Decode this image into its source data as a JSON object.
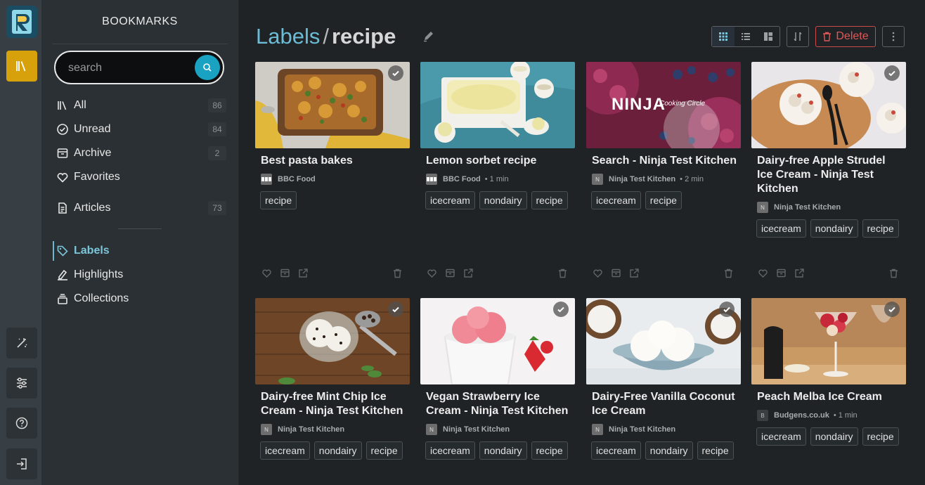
{
  "rail": {
    "logo_letter": "R",
    "items": [
      {
        "name": "bookmarks",
        "icon": "library-icon",
        "active": true
      },
      {
        "name": "nav-toggle",
        "icon": "magic-wand-icon"
      },
      {
        "name": "settings",
        "icon": "sliders-icon"
      },
      {
        "name": "help",
        "icon": "help-circle-icon"
      },
      {
        "name": "logout",
        "icon": "logout-icon"
      }
    ]
  },
  "sidebar": {
    "title": "BOOKMARKS",
    "search_placeholder": "search",
    "items": [
      {
        "label": "All",
        "count": "86",
        "icon": "library-icon"
      },
      {
        "label": "Unread",
        "count": "84",
        "icon": "check-circle-icon"
      },
      {
        "label": "Archive",
        "count": "2",
        "icon": "archive-icon"
      },
      {
        "label": "Favorites",
        "count": "",
        "icon": "heart-icon"
      },
      {
        "label": "Articles",
        "count": "73",
        "icon": "document-icon"
      },
      {
        "label": "Labels",
        "count": "",
        "icon": "tag-icon",
        "active": true
      },
      {
        "label": "Highlights",
        "count": "",
        "icon": "highlighter-icon"
      },
      {
        "label": "Collections",
        "count": "",
        "icon": "collections-icon"
      }
    ]
  },
  "header": {
    "crumb": "Labels",
    "separator": "/",
    "current": "recipe",
    "delete_label": "Delete"
  },
  "colors": {
    "accent": "#6bbcd6",
    "active_rail": "#d6a10a",
    "delete": "#e05858"
  },
  "cards": [
    {
      "title": "Best pasta bakes",
      "site": "BBC Food",
      "reading_time": "",
      "favicon": "bbc",
      "tags": [
        "recipe"
      ]
    },
    {
      "title": "Lemon sorbet recipe",
      "site": "BBC Food",
      "reading_time": "• 1 min",
      "favicon": "bbc",
      "tags": [
        "icecream",
        "nondairy",
        "recipe"
      ]
    },
    {
      "title": "Search - Ninja Test Kitchen",
      "site": "Ninja Test Kitchen",
      "reading_time": "• 2 min",
      "favicon": "ninja",
      "tags": [
        "icecream",
        "recipe"
      ],
      "overlay_brand": "NINJA",
      "overlay_sub": "Cooking Circle"
    },
    {
      "title": "Dairy-free Apple Strudel Ice Cream - Ninja Test Kitchen",
      "site": "Ninja Test Kitchen",
      "reading_time": "",
      "favicon": "ninja",
      "tags": [
        "icecream",
        "nondairy",
        "recipe"
      ]
    },
    {
      "title": "Dairy-free Mint Chip Ice Cream - Ninja Test Kitchen",
      "site": "Ninja Test Kitchen",
      "reading_time": "",
      "favicon": "ninja",
      "tags": [
        "icecream",
        "nondairy",
        "recipe"
      ]
    },
    {
      "title": "Vegan Strawberry Ice Cream - Ninja Test Kitchen",
      "site": "Ninja Test Kitchen",
      "reading_time": "",
      "favicon": "ninja",
      "tags": [
        "icecream",
        "nondairy",
        "recipe"
      ]
    },
    {
      "title": "Dairy-Free Vanilla Coconut Ice Cream",
      "site": "Ninja Test Kitchen",
      "reading_time": "",
      "favicon": "ninja",
      "tags": [
        "icecream",
        "nondairy",
        "recipe"
      ]
    },
    {
      "title": "Peach Melba Ice Cream",
      "site": "Budgens.co.uk",
      "reading_time": "• 1 min",
      "favicon": "B",
      "tags": [
        "icecream",
        "nondairy",
        "recipe"
      ]
    }
  ]
}
